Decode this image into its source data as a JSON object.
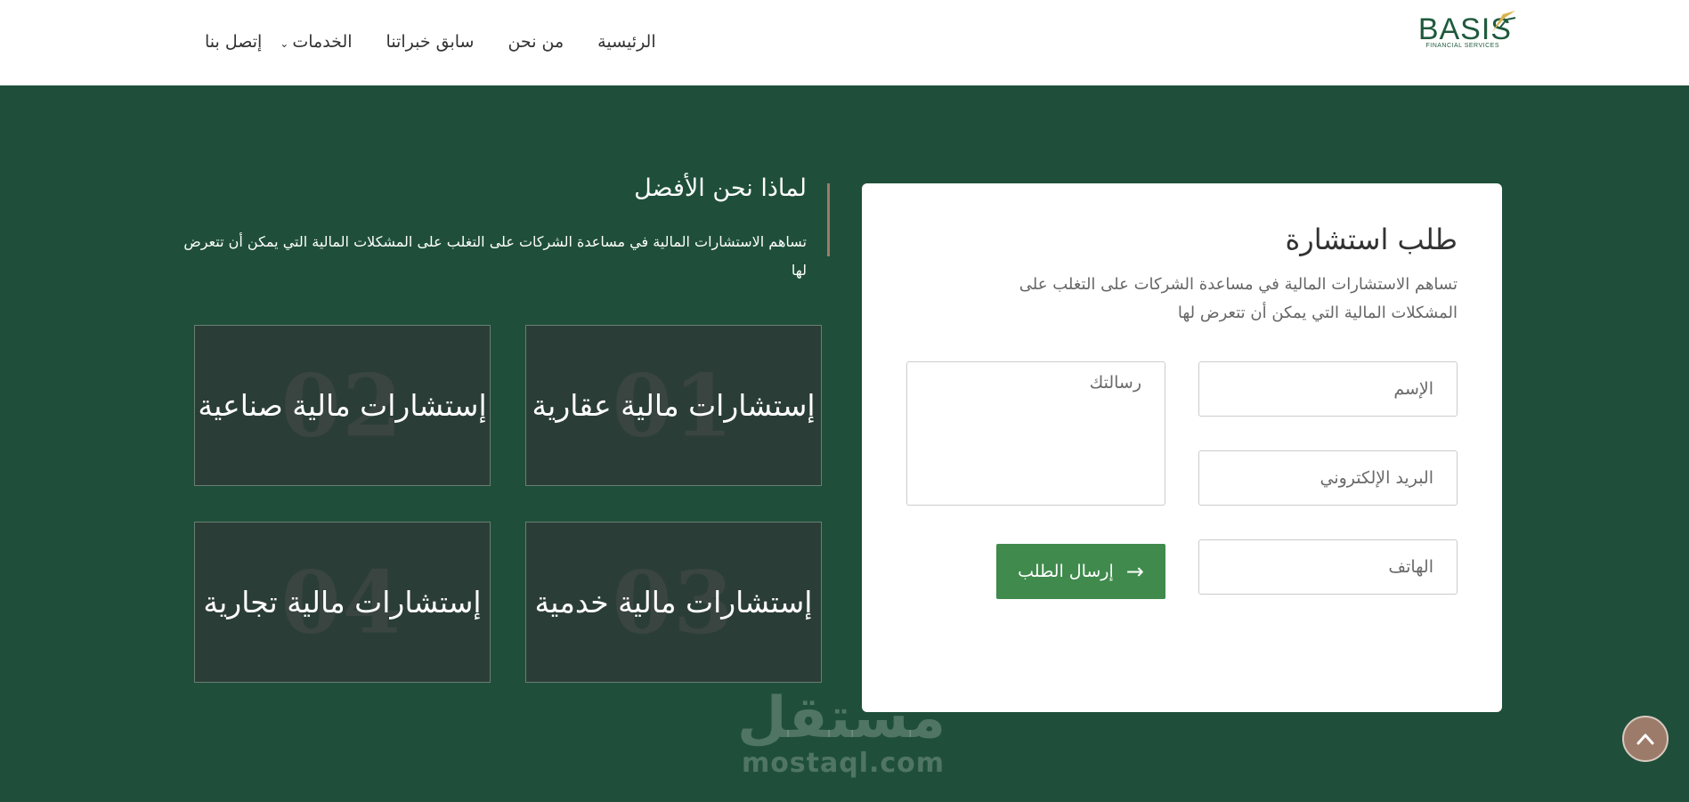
{
  "brand": {
    "name": "BASIS",
    "tagline": "FINANCIAL SERVICES"
  },
  "nav": {
    "home": "الرئيسية",
    "about": "من نحن",
    "portfolio": "سابق خبراتنا",
    "services": "الخدمات",
    "contact": "إتصل بنا"
  },
  "why": {
    "title": "لماذا نحن الأفضل",
    "text": "تساهم الاستشارات المالية في مساعدة الشركات على التغلب على المشكلات المالية التي يمكن أن تتعرض لها"
  },
  "cards": [
    {
      "number": "01",
      "title": "إستشارات مالية عقارية"
    },
    {
      "number": "02",
      "title": "إستشارات مالية صناعية"
    },
    {
      "number": "03",
      "title": "إستشارات مالية خدمية"
    },
    {
      "number": "04",
      "title": "إستشارات مالية تجارية"
    }
  ],
  "form": {
    "title": "طلب استشارة",
    "description": "تساهم الاستشارات المالية في مساعدة الشركات على التغلب على المشكلات المالية التي يمكن أن تتعرض لها",
    "name_placeholder": "الإسم",
    "email_placeholder": "البريد الإلكتروني",
    "phone_placeholder": "الهاتف",
    "message_placeholder": "رسالتك",
    "submit_label": "إرسال الطلب"
  },
  "watermark": {
    "arabic": "مستقل",
    "latin": "mostaql.com"
  },
  "colors": {
    "background": "#1f4f3a",
    "card": "#2b3d37",
    "accent": "#3f8a4c",
    "bronze": "#9d7b6a"
  }
}
